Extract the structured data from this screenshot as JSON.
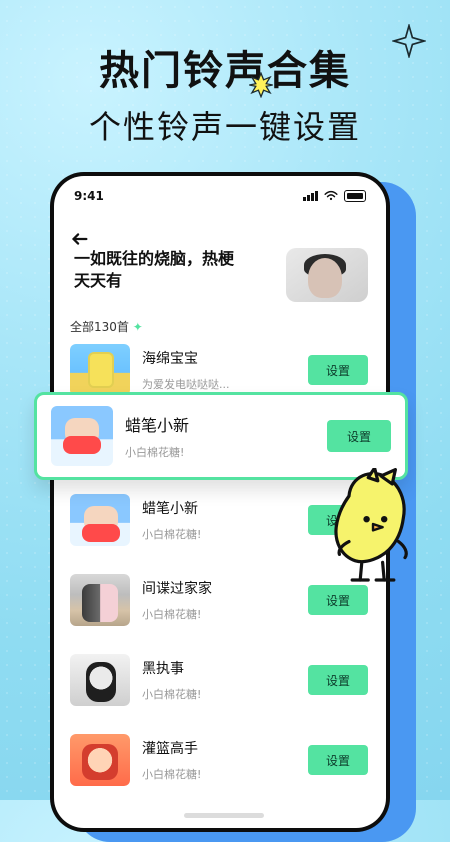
{
  "promo": {
    "headline": "热门铃声合集",
    "subhead": "个性铃声一键设置"
  },
  "status_bar": {
    "time": "9:41"
  },
  "page": {
    "hero_text": "一如既往的烧脑，热梗天天有",
    "count_label": "全部130首"
  },
  "ringtones": [
    {
      "title": "海绵宝宝",
      "subtitle": "为爱发电哒哒哒...",
      "button": "设置",
      "thumb": "spongebob"
    },
    {
      "title": "蜡笔小新",
      "subtitle": "小白棉花糖!",
      "button": "设置",
      "thumb": "shin"
    },
    {
      "title": "蜡笔小新",
      "subtitle": "小白棉花糖!",
      "button": "设置",
      "thumb": "shin"
    },
    {
      "title": "间谍过家家",
      "subtitle": "小白棉花糖!",
      "button": "设置",
      "thumb": "spy"
    },
    {
      "title": "黑执事",
      "subtitle": "小白棉花糖!",
      "button": "设置",
      "thumb": "butler"
    },
    {
      "title": "灌篮高手",
      "subtitle": "小白棉花糖!",
      "button": "设置",
      "thumb": "slam"
    }
  ],
  "icons": {
    "back": "back-arrow-icon",
    "sparkle": "sparkle-icon",
    "starburst": "starburst-icon",
    "mascot": "chick-mascot"
  },
  "colors": {
    "accent_green": "#54e3a1",
    "phone_blue": "#4a98f2",
    "bg_cyan": "#8fdcf2"
  }
}
